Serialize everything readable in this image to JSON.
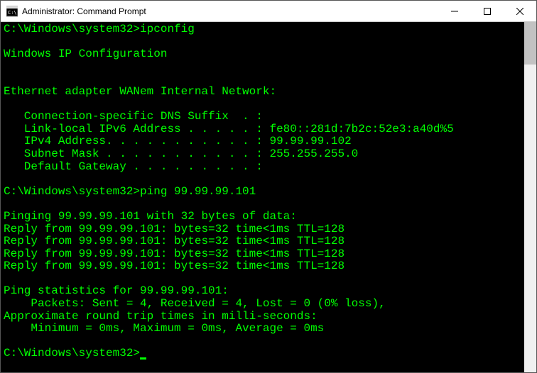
{
  "window": {
    "title": "Administrator: Command Prompt"
  },
  "term": {
    "prompt1": "C:\\Windows\\system32>",
    "cmd1": "ipconfig",
    "blank": "",
    "header": "Windows IP Configuration",
    "adapter": "Ethernet adapter WANem Internal Network:",
    "dns": "   Connection-specific DNS Suffix  . :",
    "ipv6": "   Link-local IPv6 Address . . . . . : fe80::281d:7b2c:52e3:a40d%5",
    "ipv4": "   IPv4 Address. . . . . . . . . . . : 99.99.99.102",
    "mask": "   Subnet Mask . . . . . . . . . . . : 255.255.255.0",
    "gw": "   Default Gateway . . . . . . . . . :",
    "prompt2": "C:\\Windows\\system32>",
    "cmd2": "ping 99.99.99.101",
    "pinging": "Pinging 99.99.99.101 with 32 bytes of data:",
    "reply1": "Reply from 99.99.99.101: bytes=32 time<1ms TTL=128",
    "reply2": "Reply from 99.99.99.101: bytes=32 time<1ms TTL=128",
    "reply3": "Reply from 99.99.99.101: bytes=32 time<1ms TTL=128",
    "reply4": "Reply from 99.99.99.101: bytes=32 time<1ms TTL=128",
    "stats": "Ping statistics for 99.99.99.101:",
    "packets": "    Packets: Sent = 4, Received = 4, Lost = 0 (0% loss),",
    "approx": "Approximate round trip times in milli-seconds:",
    "rtt": "    Minimum = 0ms, Maximum = 0ms, Average = 0ms",
    "prompt3": "C:\\Windows\\system32>"
  }
}
